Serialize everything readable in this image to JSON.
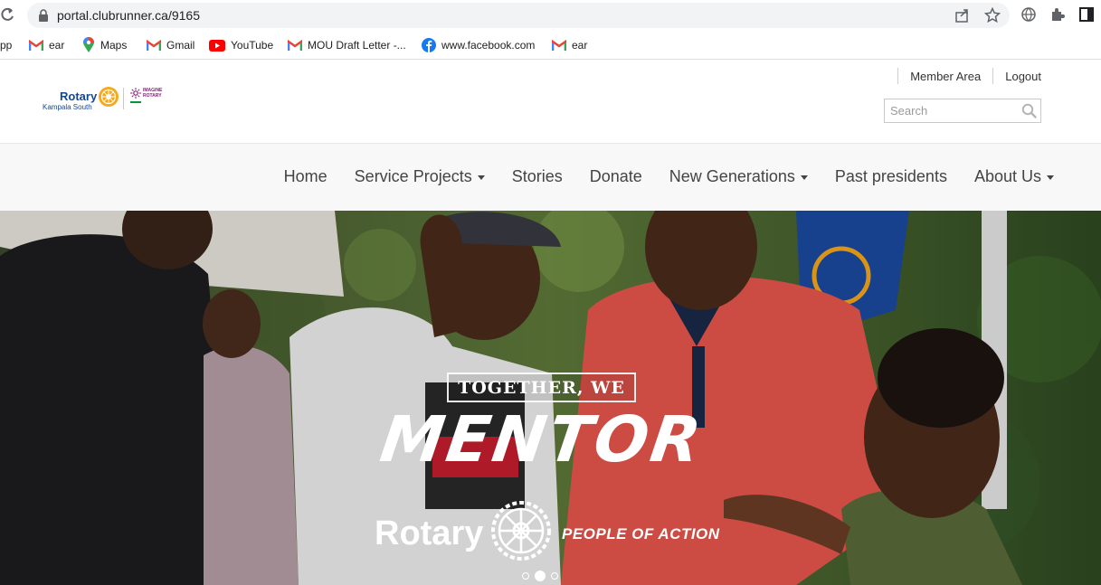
{
  "browser": {
    "url": "portal.clubrunner.ca/9165",
    "bookmarks": [
      {
        "label": "pp",
        "icon": "apps-icon"
      },
      {
        "label": "ear",
        "icon": "gmail-icon"
      },
      {
        "label": "Maps",
        "icon": "maps-icon"
      },
      {
        "label": "Gmail",
        "icon": "gmail-icon"
      },
      {
        "label": "YouTube",
        "icon": "youtube-icon"
      },
      {
        "label": "MOU Draft Letter -...",
        "icon": "gmail-icon"
      },
      {
        "label": "www.facebook.com",
        "icon": "facebook-icon"
      },
      {
        "label": "ear",
        "icon": "gmail-icon"
      }
    ]
  },
  "header": {
    "logo": {
      "name": "Rotary",
      "club": "Kampala South",
      "theme": "IMAGINE ROTARY"
    },
    "util_links": {
      "member_area": "Member Area",
      "logout": "Logout"
    },
    "search": {
      "placeholder": "Search",
      "value": ""
    }
  },
  "nav": {
    "items": [
      {
        "label": "Home",
        "dropdown": false
      },
      {
        "label": "Service Projects",
        "dropdown": true
      },
      {
        "label": "Stories",
        "dropdown": false
      },
      {
        "label": "Donate",
        "dropdown": false
      },
      {
        "label": "New Generations",
        "dropdown": true
      },
      {
        "label": "Past presidents",
        "dropdown": false
      },
      {
        "label": "About Us",
        "dropdown": true
      }
    ]
  },
  "hero": {
    "tagline": "TOGETHER, WE",
    "headline": "MENTOR",
    "brand": "Rotary",
    "slogan": "PEOPLE OF ACTION",
    "slides_total": 3,
    "active_slide": 2
  },
  "colors": {
    "rotary_blue": "#17458f",
    "rotary_gold": "#f7a81b",
    "imagine_purple": "#872175"
  }
}
